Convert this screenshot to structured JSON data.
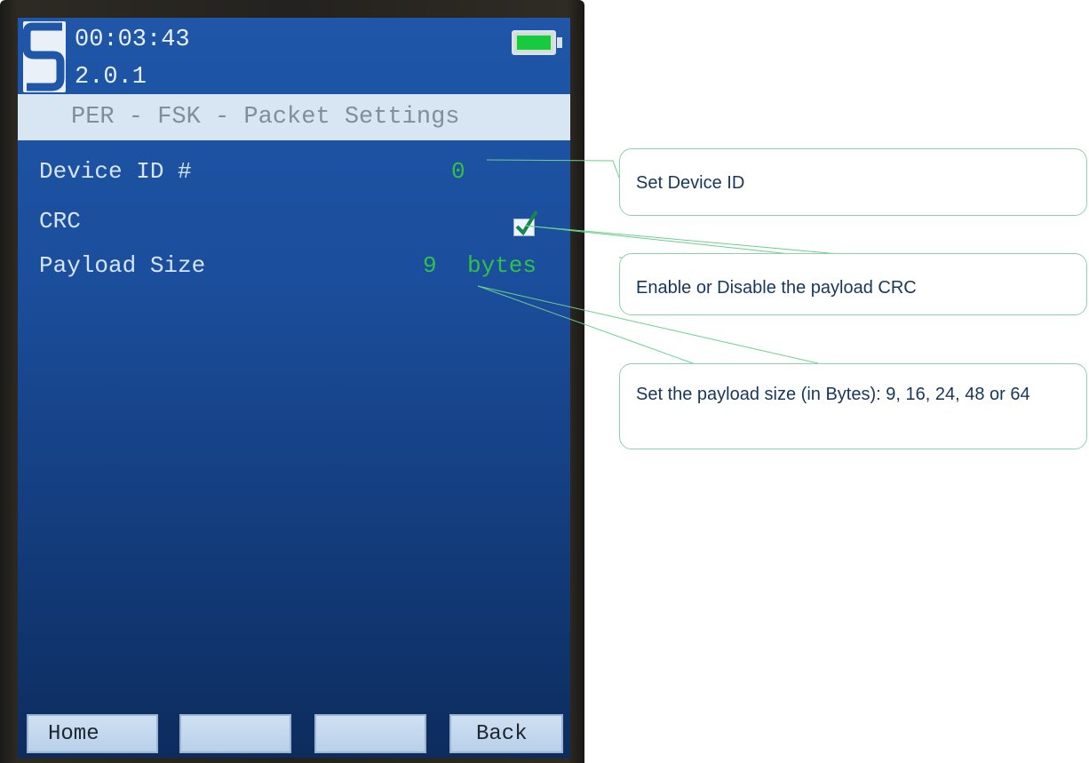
{
  "device": {
    "status": {
      "clock": "00:03:43",
      "version": "2.0.1",
      "battery_icon": "battery-full-icon",
      "battery_level": 1.0
    },
    "screen_title": "PER - FSK - Packet Settings",
    "settings": [
      {
        "label": "Device ID #",
        "value": "0"
      },
      {
        "label": "CRC",
        "value_type": "checkbox",
        "checked": true
      },
      {
        "label": "Payload Size",
        "value": "9",
        "unit": "bytes"
      }
    ],
    "softkeys": [
      "Home",
      "",
      "",
      "Back"
    ]
  },
  "callouts": [
    {
      "text": "Set Device ID"
    },
    {
      "text": "Enable or Disable the payload CRC"
    },
    {
      "text": "Set the payload size (in Bytes): 9, 16, 24, 48 or 64"
    }
  ],
  "colors": {
    "screen_blue": "#1b4e9c",
    "value_green": "#2fc24a",
    "title_bar": "#d8e6f4",
    "callout_border": "#8fd3a8",
    "callout_text": "#17365d"
  }
}
